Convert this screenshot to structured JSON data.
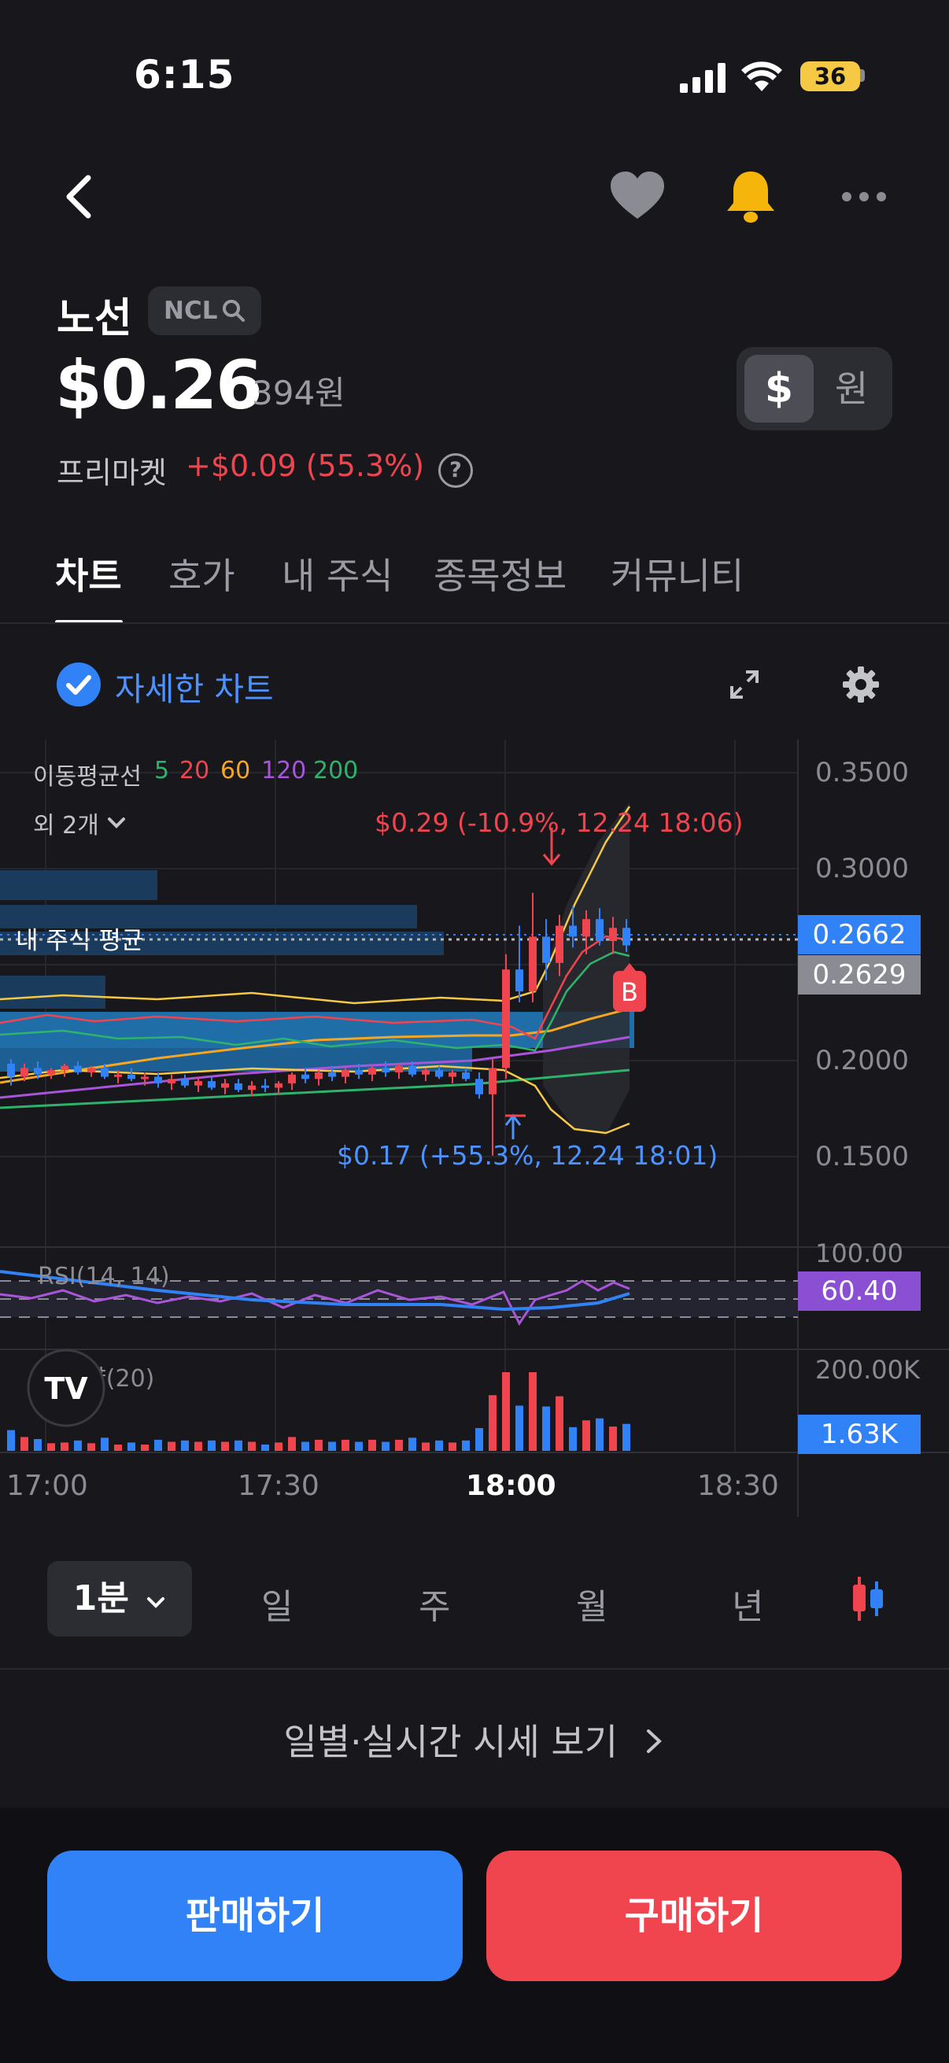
{
  "status_bar": {
    "time": "6:15",
    "battery": "36"
  },
  "stock": {
    "name": "노선",
    "ticker": "NCL",
    "price": "$0.26",
    "price_krw": "394원",
    "session": "프리마켓",
    "change": "+$0.09 (55.3%)",
    "help": "?"
  },
  "currency_toggle": {
    "usd": "$",
    "krw": "원"
  },
  "tabs": [
    {
      "label": "차트"
    },
    {
      "label": "호가"
    },
    {
      "label": "내 주식"
    },
    {
      "label": "종목정보"
    },
    {
      "label": "커뮤니티"
    }
  ],
  "detail_chart_label": "자세한 차트",
  "chart": {
    "ma_label": "이동평균선",
    "ma_periods": [
      "5",
      "20",
      "60",
      "120",
      "200"
    ],
    "ma_colors": [
      "#2fb36b",
      "#f0444f",
      "#f5a623",
      "#a855d9",
      "#2fb36b"
    ],
    "extra_label": "외 2개",
    "my_avg_label": "내 주식 평균",
    "high_annotation": "$0.29 (-10.9%, 12.24 18:06)",
    "low_annotation": "$0.17 (+55.3%, 12.24 18:01)",
    "buy_marker": "B",
    "rsi_label": "RSI(14, 14)",
    "volume_label": "거래량(20)",
    "y_ticks": [
      "0.3500",
      "0.3000",
      "0.2000",
      "0.1500"
    ],
    "current_price_tag": "0.2662",
    "avg_price_tag": "0.2629",
    "rsi_top": "100.00",
    "rsi_value": "60.40",
    "volume_top": "200.00K",
    "volume_value": "1.63K",
    "x_ticks": [
      "17:00",
      "17:30",
      "18:00",
      "18:30"
    ],
    "logo": "TV"
  },
  "periods": {
    "selected": "1분",
    "items": [
      "일",
      "주",
      "월",
      "년"
    ]
  },
  "daily_link": "일별·실시간 시세 보기",
  "actions": {
    "sell": "판매하기",
    "buy": "구매하기"
  },
  "colors": {
    "up": "#f0444f",
    "down": "#3182f6",
    "accent": "#3182f6",
    "bell": "#f5b50a"
  },
  "chart_data": {
    "type": "candlestick",
    "x_ticks": [
      "17:00",
      "17:30",
      "18:00",
      "18:30"
    ],
    "ylim": [
      0.13,
      0.36
    ],
    "price_labels": [
      0.35,
      0.3,
      0.2,
      0.15
    ],
    "current_price": 0.2662,
    "my_average": 0.2629,
    "high": {
      "value": 0.29,
      "time": "12.24 18:06"
    },
    "low": {
      "value": 0.17,
      "time": "12.24 18:01"
    },
    "rsi": {
      "value": 60.4,
      "max": 100
    },
    "volume": {
      "value": "1.63K",
      "max": "200.00K"
    },
    "candles": [
      [
        0.212,
        0.214,
        0.202,
        0.206
      ],
      [
        0.206,
        0.212,
        0.204,
        0.21
      ],
      [
        0.21,
        0.213,
        0.205,
        0.207
      ],
      [
        0.207,
        0.21,
        0.205,
        0.209
      ],
      [
        0.209,
        0.212,
        0.206,
        0.211
      ],
      [
        0.211,
        0.213,
        0.207,
        0.208
      ],
      [
        0.208,
        0.211,
        0.206,
        0.21
      ],
      [
        0.21,
        0.212,
        0.205,
        0.206
      ],
      [
        0.206,
        0.209,
        0.203,
        0.207
      ],
      [
        0.207,
        0.21,
        0.204,
        0.205
      ],
      [
        0.205,
        0.208,
        0.202,
        0.206
      ],
      [
        0.206,
        0.208,
        0.201,
        0.203
      ],
      [
        0.203,
        0.207,
        0.2,
        0.205
      ],
      [
        0.205,
        0.207,
        0.201,
        0.202
      ],
      [
        0.202,
        0.206,
        0.199,
        0.204
      ],
      [
        0.204,
        0.206,
        0.2,
        0.201
      ],
      [
        0.201,
        0.205,
        0.198,
        0.203
      ],
      [
        0.203,
        0.205,
        0.199,
        0.2
      ],
      [
        0.2,
        0.204,
        0.197,
        0.202
      ],
      [
        0.202,
        0.205,
        0.199,
        0.201
      ],
      [
        0.201,
        0.204,
        0.198,
        0.203
      ],
      [
        0.203,
        0.208,
        0.2,
        0.207
      ],
      [
        0.207,
        0.21,
        0.203,
        0.205
      ],
      [
        0.205,
        0.209,
        0.202,
        0.208
      ],
      [
        0.208,
        0.211,
        0.204,
        0.206
      ],
      [
        0.206,
        0.21,
        0.203,
        0.209
      ],
      [
        0.209,
        0.212,
        0.205,
        0.207
      ],
      [
        0.207,
        0.211,
        0.204,
        0.21
      ],
      [
        0.21,
        0.213,
        0.206,
        0.208
      ],
      [
        0.208,
        0.212,
        0.205,
        0.211
      ],
      [
        0.211,
        0.213,
        0.206,
        0.207
      ],
      [
        0.207,
        0.21,
        0.204,
        0.209
      ],
      [
        0.209,
        0.211,
        0.205,
        0.206
      ],
      [
        0.206,
        0.209,
        0.203,
        0.208
      ],
      [
        0.208,
        0.21,
        0.204,
        0.205
      ],
      [
        0.205,
        0.208,
        0.196,
        0.198
      ],
      [
        0.198,
        0.214,
        0.17,
        0.21
      ],
      [
        0.21,
        0.262,
        0.205,
        0.255
      ],
      [
        0.255,
        0.275,
        0.24,
        0.245
      ],
      [
        0.245,
        0.29,
        0.24,
        0.27
      ],
      [
        0.27,
        0.278,
        0.25,
        0.258
      ],
      [
        0.258,
        0.28,
        0.252,
        0.275
      ],
      [
        0.275,
        0.284,
        0.265,
        0.27
      ],
      [
        0.27,
        0.282,
        0.262,
        0.278
      ],
      [
        0.278,
        0.283,
        0.266,
        0.268
      ],
      [
        0.268,
        0.279,
        0.262,
        0.274
      ],
      [
        0.274,
        0.278,
        0.263,
        0.266
      ]
    ]
  }
}
